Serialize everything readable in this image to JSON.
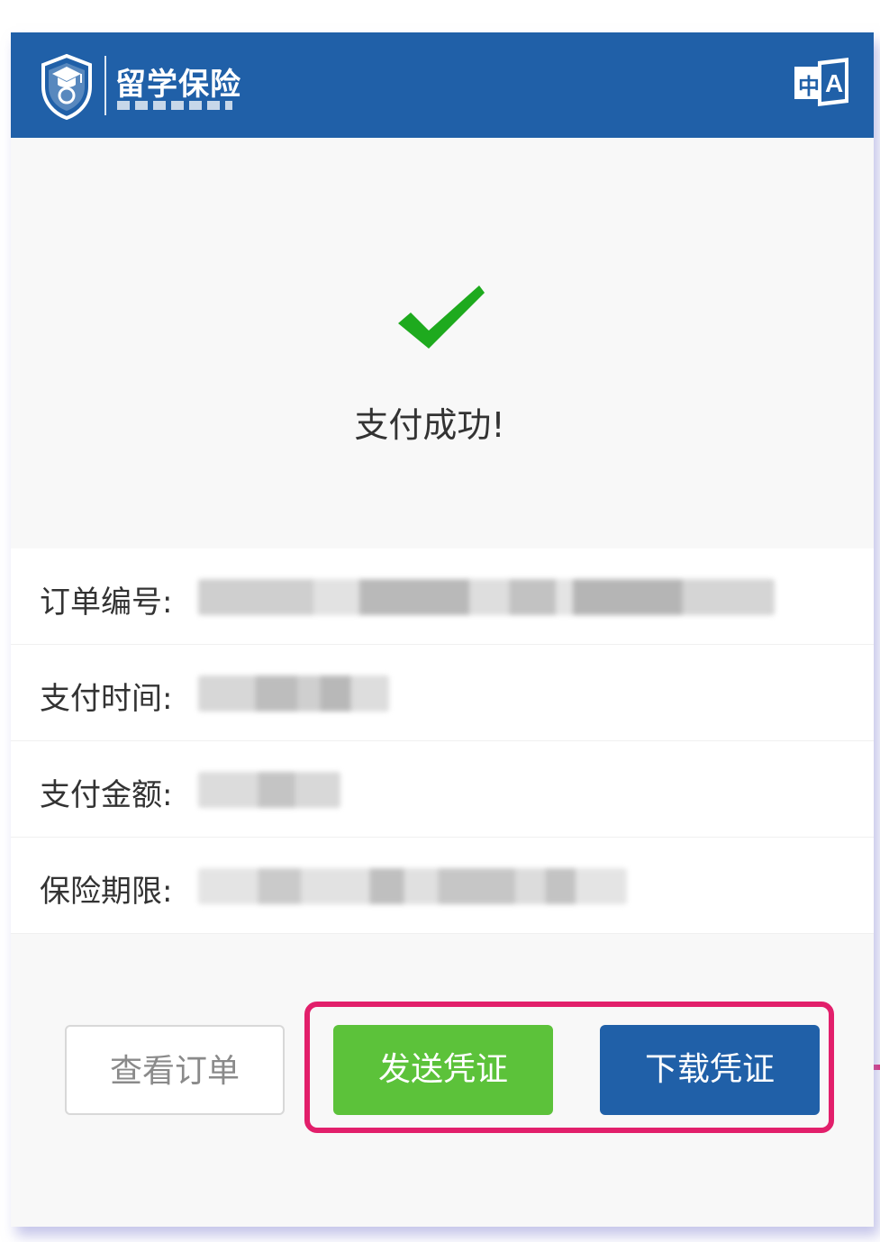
{
  "header": {
    "brand_title": "留学保险",
    "lang_icon": "translate-icon",
    "brand_color": "#2060a8"
  },
  "status": {
    "icon": "checkmark-icon",
    "icon_color": "#1eaa1e",
    "message": "支付成功!"
  },
  "order_info": {
    "rows": [
      {
        "label": "订单编号:"
      },
      {
        "label": "支付时间:"
      },
      {
        "label": "支付金额:"
      },
      {
        "label": "保险期限:"
      }
    ]
  },
  "actions": {
    "view_order_label": "查看订单",
    "send_voucher_label": "发送凭证",
    "download_voucher_label": "下载凭证",
    "send_color": "#5cc23a",
    "download_color": "#2060a8",
    "highlight_color": "#e21f6b"
  }
}
